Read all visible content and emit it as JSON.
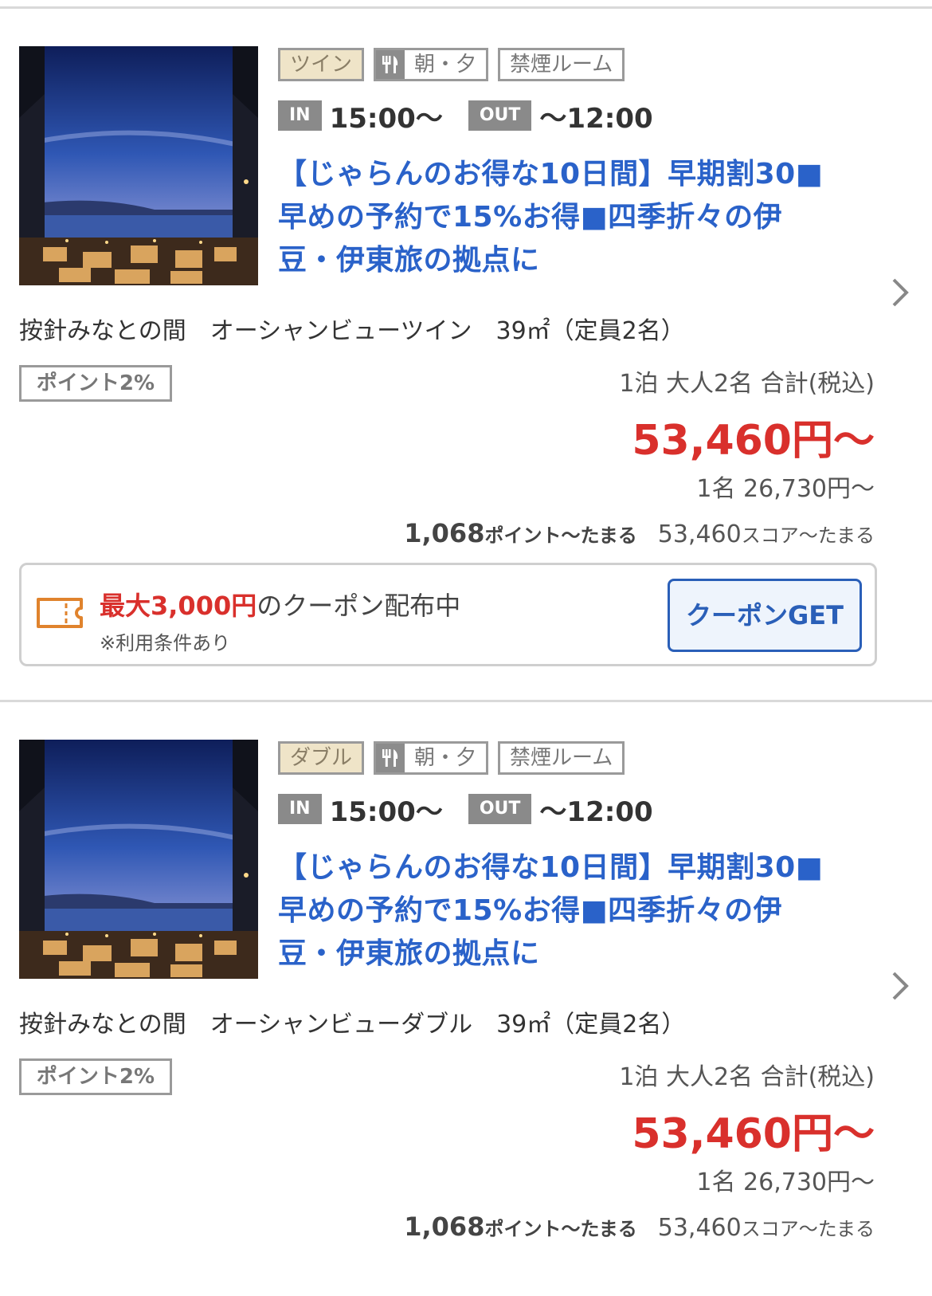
{
  "plans": [
    {
      "room_type": "ツイン",
      "meal": "朝・夕",
      "smoking": "禁煙ルーム",
      "checkin_label": "IN",
      "checkin_time": "15:00〜",
      "checkout_label": "OUT",
      "checkout_time": "〜12:00",
      "title_lines": [
        "【じゃらんのお得な10日間】早期割30■",
        "早めの予約で15%お得■四季折々の伊",
        "豆・伊東旅の拠点に"
      ],
      "room_name": "按針みなとの間　オーシャンビューツイン　39㎡（定員2名）",
      "point_rate": "ポイント2%",
      "stay_info": "1泊 大人2名 合計(税込)",
      "total_price": "53,460円〜",
      "per_person": "1名 26,730円〜",
      "earn_points_num": "1,068",
      "earn_points_text": "ポイント〜たまる",
      "earn_score_num": "53,460",
      "earn_score_text": "スコア〜たまる",
      "coupon": {
        "amount": "最大3,000円",
        "text": "のクーポン配布中",
        "note": "※利用条件あり",
        "button_label": "クーポンGET"
      }
    },
    {
      "room_type": "ダブル",
      "meal": "朝・夕",
      "smoking": "禁煙ルーム",
      "checkin_label": "IN",
      "checkin_time": "15:00〜",
      "checkout_label": "OUT",
      "checkout_time": "〜12:00",
      "title_lines": [
        "【じゃらんのお得な10日間】早期割30■",
        "早めの予約で15%お得■四季折々の伊",
        "豆・伊東旅の拠点に"
      ],
      "room_name": "按針みなとの間　オーシャンビューダブル　39㎡（定員2名）",
      "point_rate": "ポイント2%",
      "stay_info": "1泊 大人2名 合計(税込)",
      "total_price": "53,460円〜",
      "per_person": "1名 26,730円〜",
      "earn_points_num": "1,068",
      "earn_points_text": "ポイント〜たまる",
      "earn_score_num": "53,460",
      "earn_score_text": "スコア〜たまる"
    }
  ],
  "icons": {
    "meal": "fork-knife-icon",
    "coupon": "ticket-icon",
    "chevron": "chevron-right-icon"
  },
  "colors": {
    "price_red": "#d9302c",
    "title_blue": "#2a62c9",
    "button_blue": "#2a5fb8"
  }
}
